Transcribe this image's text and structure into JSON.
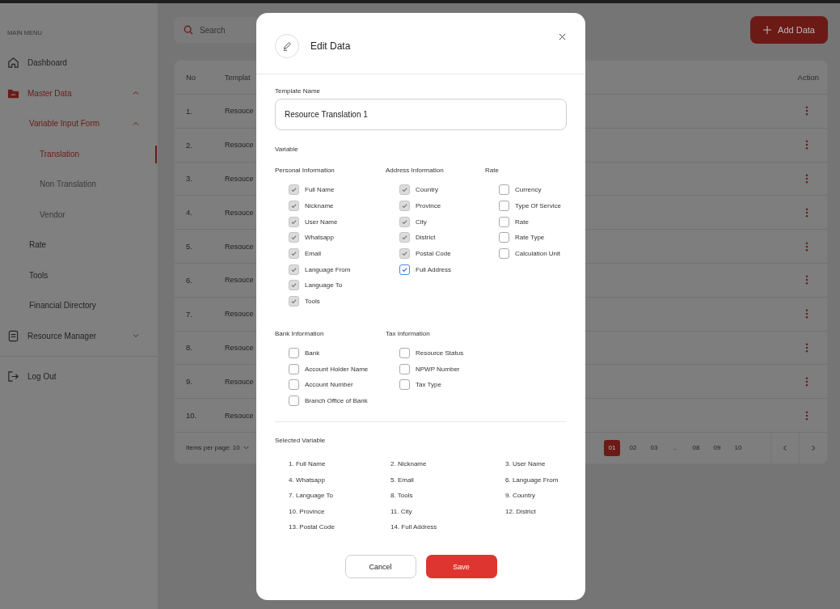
{
  "sidebar": {
    "heading": "MAIN MENU",
    "items": [
      {
        "label": "Dashboard",
        "selected": false
      },
      {
        "label": "Master Data",
        "expanded": true,
        "children": [
          {
            "label": "Variable Input Form",
            "expanded": true,
            "children": [
              {
                "label": "Translation",
                "selected": true
              },
              {
                "label": "Non Translation",
                "selected": false
              },
              {
                "label": "Vendor",
                "selected": false
              }
            ]
          },
          {
            "label": "Rate",
            "selected": false
          },
          {
            "label": "Tools",
            "selected": false
          },
          {
            "label": "Financial Directory",
            "selected": false
          }
        ]
      },
      {
        "label": "Resource Manager",
        "selected": false,
        "expanded": false
      }
    ],
    "logout": "Log Out"
  },
  "search": {
    "placeholder": "Search"
  },
  "add_button": "Add Data",
  "table": {
    "columns": [
      "No",
      "Templat",
      "Action"
    ],
    "rows": [
      {
        "no": "1.",
        "name": "Resouce"
      },
      {
        "no": "2.",
        "name": "Resouce"
      },
      {
        "no": "3.",
        "name": "Resouce"
      },
      {
        "no": "4.",
        "name": "Resouce"
      },
      {
        "no": "5.",
        "name": "Resouce"
      },
      {
        "no": "6.",
        "name": "Resouce"
      },
      {
        "no": "7.",
        "name": "Resouce"
      },
      {
        "no": "8.",
        "name": "Resouce"
      },
      {
        "no": "9.",
        "name": "Resouce"
      },
      {
        "no": "10.",
        "name": "Resouce"
      }
    ],
    "items_per_page": "Items per page: 10",
    "pages": [
      {
        "label": "01",
        "selected": true
      },
      {
        "label": "02",
        "selected": false
      },
      {
        "label": "03",
        "selected": false
      },
      {
        "label": "..",
        "selected": false
      },
      {
        "label": "08",
        "selected": false
      },
      {
        "label": "09",
        "selected": false
      },
      {
        "label": "10",
        "selected": false
      }
    ]
  },
  "modal": {
    "title": "Edit Data",
    "template_label": "Template Name",
    "template_value": "Resource Translation 1",
    "variable_label": "Variable",
    "groups": [
      {
        "title": "Personal Information",
        "items": [
          {
            "label": "Full Name",
            "checked": true,
            "disabled": true
          },
          {
            "label": "Nickname",
            "checked": true,
            "disabled": true
          },
          {
            "label": "User Name",
            "checked": true,
            "disabled": true
          },
          {
            "label": "Whatsapp",
            "checked": true,
            "disabled": true
          },
          {
            "label": "Email",
            "checked": true,
            "disabled": true
          },
          {
            "label": "Language From",
            "checked": true,
            "disabled": true
          },
          {
            "label": "Language To",
            "checked": true,
            "disabled": true
          },
          {
            "label": "Tools",
            "checked": true,
            "disabled": true
          }
        ]
      },
      {
        "title": "Address Information",
        "items": [
          {
            "label": "Country",
            "checked": true,
            "disabled": true
          },
          {
            "label": "Province",
            "checked": true,
            "disabled": true
          },
          {
            "label": "City",
            "checked": true,
            "disabled": true
          },
          {
            "label": "District",
            "checked": true,
            "disabled": true
          },
          {
            "label": "Postal Code",
            "checked": true,
            "disabled": true
          },
          {
            "label": "Full Address",
            "checked": true,
            "disabled": false
          }
        ]
      },
      {
        "title": "Rate",
        "items": [
          {
            "label": "Currency",
            "checked": false,
            "disabled": false
          },
          {
            "label": "Type Of Service",
            "checked": false,
            "disabled": false
          },
          {
            "label": "Rate",
            "checked": false,
            "disabled": false
          },
          {
            "label": "Rate Type",
            "checked": false,
            "disabled": false
          },
          {
            "label": "Calculation Unit",
            "checked": false,
            "disabled": false
          }
        ]
      },
      {
        "title": "Bank Information",
        "items": [
          {
            "label": "Bank",
            "checked": false,
            "disabled": false
          },
          {
            "label": "Account Holder Name",
            "checked": false,
            "disabled": false
          },
          {
            "label": "Account Number",
            "checked": false,
            "disabled": false
          },
          {
            "label": "Branch Office of Bank",
            "checked": false,
            "disabled": false
          }
        ]
      },
      {
        "title": "Tax Information",
        "items": [
          {
            "label": "Resource Status",
            "checked": false,
            "disabled": false
          },
          {
            "label": "NPWP Number",
            "checked": false,
            "disabled": false
          },
          {
            "label": "Tax Type",
            "checked": false,
            "disabled": false
          }
        ]
      }
    ],
    "selected_label": "Selected Variable",
    "selected": [
      "1. Full Name",
      "2. Nickname",
      "3. User Name",
      "4. Whatsapp",
      "5. Email",
      "6. Language From",
      "7. Language To",
      "8. Tools",
      "9. Country",
      "10. Province",
      "11. City",
      "12. District",
      "13. Postal Code",
      "14. Full Address"
    ],
    "cancel": "Cancel",
    "save": "Save"
  }
}
